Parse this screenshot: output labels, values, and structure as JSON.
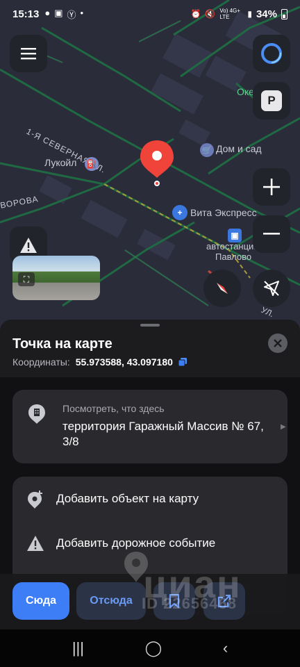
{
  "status_bar": {
    "time": "15:13",
    "signal_text": "Vo) 4G+ LTE",
    "battery": "34%"
  },
  "map": {
    "labels": {
      "street_north": "1-Я СЕВЕРНАЯ УЛ.",
      "street_west": "ВОРОВА",
      "street_east": "УЛ.",
      "lukoil": "Лукойл",
      "dom_i_sad": "Дом и сад",
      "vita": "Вита Экспресс",
      "okey": "Окей",
      "bus_station_1": "автостанци.",
      "bus_station_2": "Павлово"
    },
    "parking_letter": "P"
  },
  "sheet": {
    "title": "Точка на карте",
    "coord_label": "Координаты:",
    "coord_value": "55.973588, 43.097180",
    "whats_here_label": "Посмотреть, что здесь",
    "address": "территория Гаражный Массив № 67, 3/8",
    "actions": [
      {
        "label": "Добавить объект на карту"
      },
      {
        "label": "Добавить дорожное событие"
      }
    ]
  },
  "bottom_bar": {
    "to_here": "Сюда",
    "from_here": "Отсюда"
  },
  "watermark": {
    "logo": "циан",
    "id": "ID 22656468"
  },
  "colors": {
    "accent": "#3d7df5",
    "pin": "#f0433a",
    "road": "#1f6a43",
    "sheet_bg": "#1c1c1f"
  }
}
